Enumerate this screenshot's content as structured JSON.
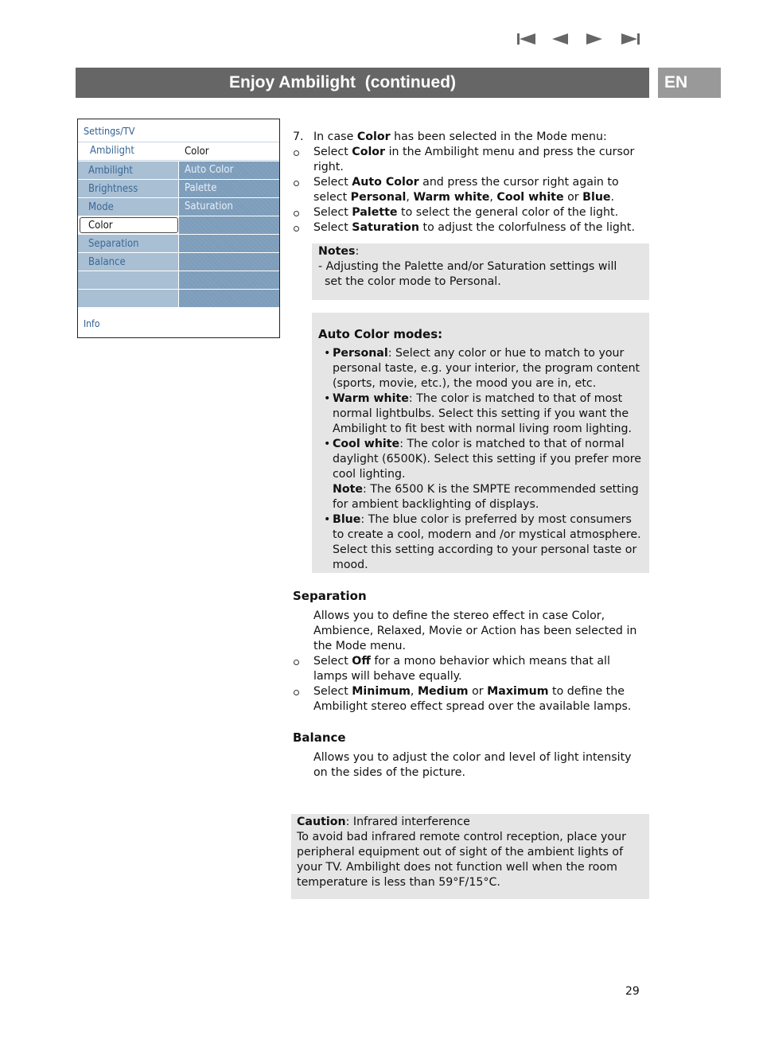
{
  "nav": {
    "icons": [
      "skip-to-first-icon",
      "previous-icon",
      "next-icon",
      "skip-to-last-icon"
    ],
    "color": "#666666"
  },
  "header": {
    "title": "Enjoy Ambilight  (continued)",
    "language": "EN",
    "title_bg": "#666666",
    "lang_bg": "#999999"
  },
  "tv_menu": {
    "breadcrumb": "Settings/TV",
    "header_left": "Ambilight",
    "header_right": "Color",
    "rows": [
      {
        "left": "Ambilight",
        "right": "Auto Color"
      },
      {
        "left": "Brightness",
        "right": "Palette"
      },
      {
        "left": "Mode",
        "right": "Saturation"
      },
      {
        "left": "Color",
        "right": "",
        "selected": true
      },
      {
        "left": "Separation",
        "right": ""
      },
      {
        "left": "Balance",
        "right": ""
      },
      {
        "left": "",
        "right": ""
      },
      {
        "left": "",
        "right": ""
      }
    ],
    "info": "Info"
  },
  "step7": {
    "number": "7.",
    "intro": [
      "In case ",
      "Color",
      " has been selected in the Mode menu:"
    ],
    "bullets": [
      [
        [
          "Select ",
          false
        ],
        [
          "Color",
          true
        ],
        [
          " in the Ambilight menu and press the cursor right.",
          false
        ]
      ],
      [
        [
          "Select ",
          false
        ],
        [
          "Auto Color",
          true
        ],
        [
          " and press the cursor right again to select ",
          false
        ],
        [
          "Personal",
          true
        ],
        [
          ", ",
          false
        ],
        [
          "Warm white",
          true
        ],
        [
          ", ",
          false
        ],
        [
          "Cool white",
          true
        ],
        [
          " or ",
          false
        ],
        [
          "Blue",
          true
        ],
        [
          ".",
          false
        ]
      ],
      [
        [
          "Select ",
          false
        ],
        [
          "Palette",
          true
        ],
        [
          " to select the general color of the light.",
          false
        ]
      ],
      [
        [
          "Select ",
          false
        ],
        [
          "Saturation",
          true
        ],
        [
          " to adjust the colorfulness of the light.",
          false
        ]
      ]
    ]
  },
  "notes": {
    "title": "Notes",
    "text": "- Adjusting the Palette and/or Saturation settings will set the color mode to Personal."
  },
  "auto_color_modes": {
    "title": "Auto Color modes:",
    "items": [
      {
        "name": "Personal",
        "text": ": Select any color or hue to match to your personal taste, e.g. your interior, the program content (sports, movie, etc.), the mood you are in, etc."
      },
      {
        "name": "Warm white",
        "text": ": The color is matched to that of most normal lightbulbs. Select this setting if you want the Ambilight to fit best with normal living room lighting."
      },
      {
        "name": "Cool white",
        "text": ": The color is matched to that of normal daylight (6500K). Select this setting if you prefer more cool lighting.",
        "note_label": "Note",
        "note_text": ": The 6500 K is the SMPTE recommended setting for ambient backlighting of displays."
      },
      {
        "name": "Blue",
        "text": ": The blue color is preferred by most consumers to create a cool, modern and /or mystical atmosphere. Select this setting according to your personal taste or mood."
      }
    ]
  },
  "separation": {
    "title": "Separation",
    "intro": "Allows you to define the stereo effect in case Color, Ambience, Relaxed, Movie or Action has been selected in the Mode menu.",
    "bullets": [
      [
        [
          "Select ",
          false
        ],
        [
          "Off",
          true
        ],
        [
          " for a mono behavior which means that all lamps will behave equally.",
          false
        ]
      ],
      [
        [
          "Select ",
          false
        ],
        [
          "Minimum",
          true
        ],
        [
          ", ",
          false
        ],
        [
          "Medium",
          true
        ],
        [
          " or ",
          false
        ],
        [
          "Maximum",
          true
        ],
        [
          " to define the Ambilight stereo effect spread over the available lamps.",
          false
        ]
      ]
    ]
  },
  "balance": {
    "title": "Balance",
    "text": "Allows you to adjust the color and level of light intensity on the sides of the picture."
  },
  "caution": {
    "label": "Caution",
    "subtitle": ": Infrared interference",
    "text": "To avoid bad infrared remote control reception, place your peripheral equipment out of sight of the ambient lights of your TV.  Ambilight does not  function well when the room temperature is less than 59°F/15°C."
  },
  "page_number": "29"
}
